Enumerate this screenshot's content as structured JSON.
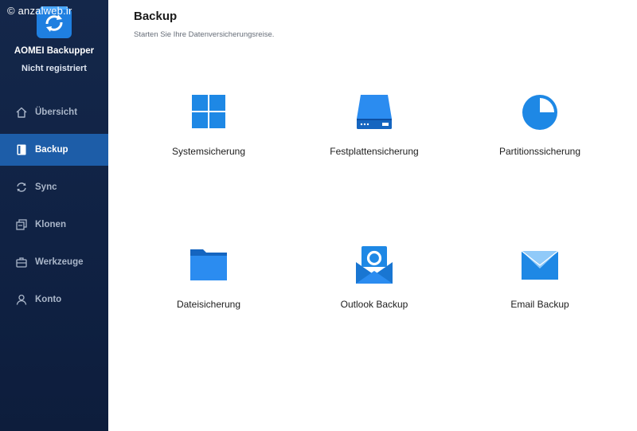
{
  "watermark": "© anzalweb.ir",
  "app": {
    "name": "AOMEI Backupper",
    "registration": "Nicht registriert"
  },
  "sidebar": {
    "items": [
      {
        "label": "Übersicht",
        "icon": "home-icon",
        "active": false
      },
      {
        "label": "Backup",
        "icon": "backup-icon",
        "active": true
      },
      {
        "label": "Sync",
        "icon": "sync-icon",
        "active": false
      },
      {
        "label": "Klonen",
        "icon": "clone-icon",
        "active": false
      },
      {
        "label": "Werkzeuge",
        "icon": "toolbox-icon",
        "active": false
      },
      {
        "label": "Konto",
        "icon": "user-icon",
        "active": false
      }
    ]
  },
  "main": {
    "title": "Backup",
    "subtitle": "Starten Sie Ihre Datenversicherungsreise.",
    "tiles": [
      {
        "label": "Systemsicherung",
        "icon": "windows-icon"
      },
      {
        "label": "Festplattensicherung",
        "icon": "hard-disk-icon"
      },
      {
        "label": "Partitionssicherung",
        "icon": "partition-pie-icon"
      },
      {
        "label": "Dateisicherung",
        "icon": "folder-icon"
      },
      {
        "label": "Outlook Backup",
        "icon": "outlook-icon"
      },
      {
        "label": "Email Backup",
        "icon": "envelope-icon"
      }
    ]
  },
  "colors": {
    "sidebar_bg": "#13264a",
    "active_nav": "#1d5da8",
    "accent_blue": "#1e88e5"
  }
}
